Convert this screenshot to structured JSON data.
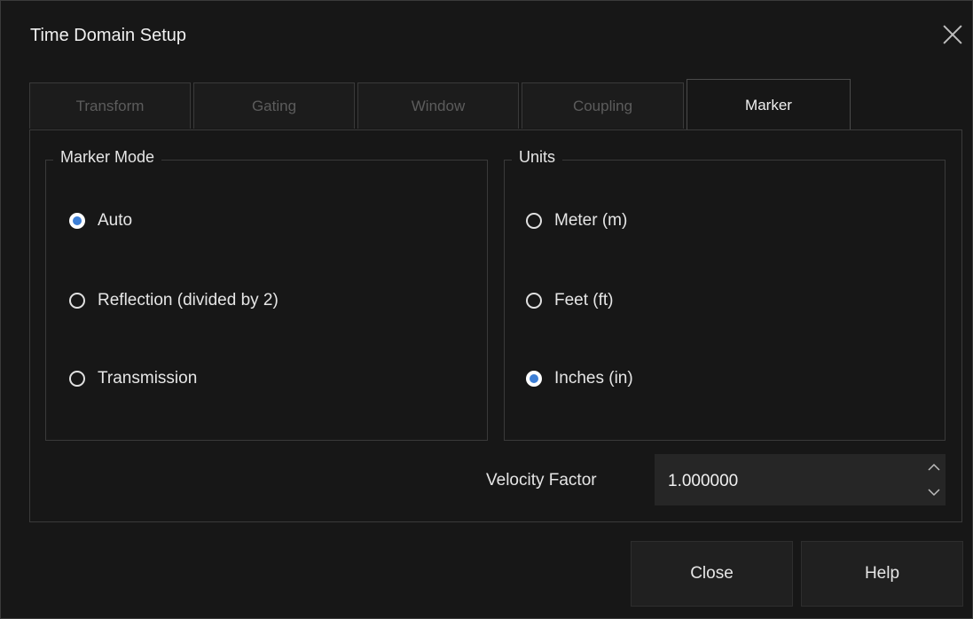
{
  "dialog": {
    "title": "Time Domain Setup",
    "close_icon": "close-icon"
  },
  "tabs": [
    {
      "label": "Transform",
      "active": false
    },
    {
      "label": "Gating",
      "active": false
    },
    {
      "label": "Window",
      "active": false
    },
    {
      "label": "Coupling",
      "active": false
    },
    {
      "label": "Marker",
      "active": true
    }
  ],
  "marker_mode": {
    "legend": "Marker Mode",
    "options": [
      {
        "label": "Auto",
        "checked": true
      },
      {
        "label": "Reflection (divided by 2)",
        "checked": false
      },
      {
        "label": "Transmission",
        "checked": false
      }
    ]
  },
  "units": {
    "legend": "Units",
    "options": [
      {
        "label": "Meter (m)",
        "checked": false
      },
      {
        "label": "Feet (ft)",
        "checked": false
      },
      {
        "label": "Inches (in)",
        "checked": true
      }
    ]
  },
  "velocity_factor": {
    "label": "Velocity Factor",
    "value": "1.000000"
  },
  "buttons": {
    "close": "Close",
    "help": "Help"
  },
  "colors": {
    "background": "#171717",
    "radio_accent": "#3d7fd6",
    "inactive_tab_text": "#5c5c5c"
  }
}
